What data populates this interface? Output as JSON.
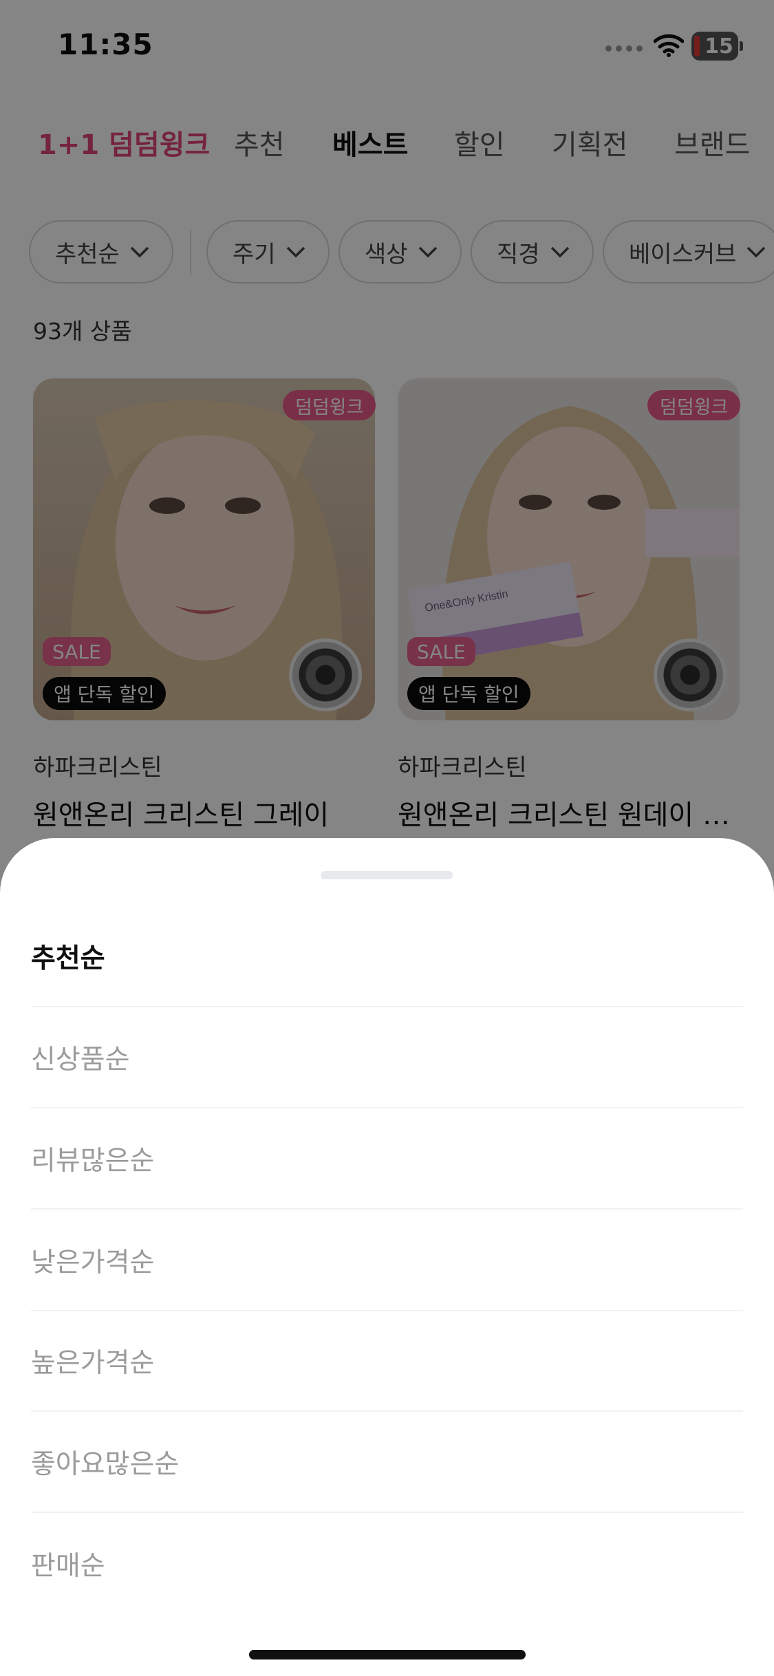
{
  "status_bar": {
    "time": "11:35",
    "battery": "15"
  },
  "top_tabs": [
    "1+1 덤덤윙크",
    "추천",
    "베스트",
    "할인",
    "기획전",
    "브랜드"
  ],
  "filters": [
    "추천순",
    "주기",
    "색상",
    "직경",
    "베이스커브"
  ],
  "product_count": "93개 상품",
  "products": [
    {
      "tag": "덤덤윙크",
      "sale": "SALE",
      "app_badge": "앱 단독 할인",
      "brand": "하파크리스틴",
      "name": "원앤온리 크리스틴 그레이"
    },
    {
      "tag": "덤덤윙크",
      "sale": "SALE",
      "app_badge": "앱 단독 할인",
      "brand": "하파크리스틴",
      "name": "원앤온리 크리스틴 원데이 그…"
    }
  ],
  "sort_sheet": {
    "selected": "추천순",
    "options": [
      "추천순",
      "신상품순",
      "리뷰많은순",
      "낮은가격순",
      "높은가격순",
      "좋아요많은순",
      "판매순"
    ]
  },
  "colors": {
    "accent": "#e0457b",
    "tag": "#ea5a8b",
    "overlay": "rgba(0,0,0,0.48)"
  }
}
